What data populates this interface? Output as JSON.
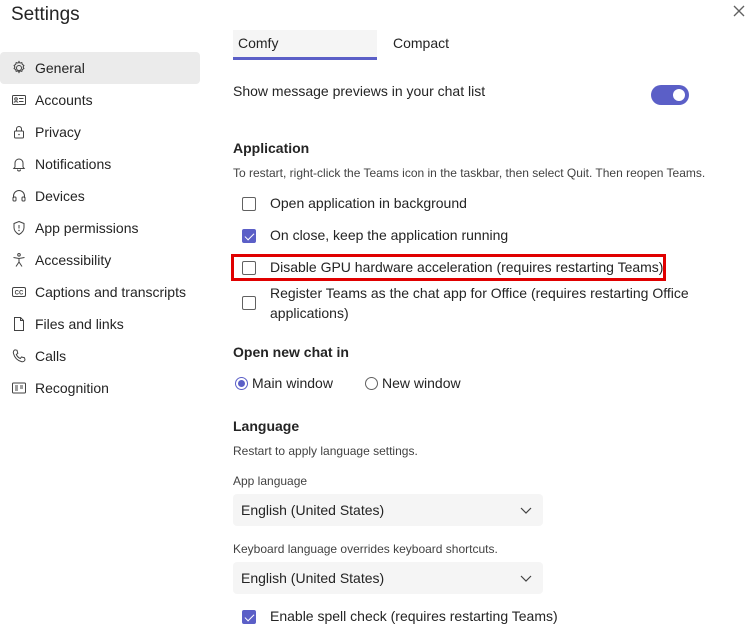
{
  "window": {
    "title": "Settings"
  },
  "sidebar": {
    "items": [
      {
        "label": "General",
        "icon": "gear-icon"
      },
      {
        "label": "Accounts",
        "icon": "id-card-icon"
      },
      {
        "label": "Privacy",
        "icon": "lock-icon"
      },
      {
        "label": "Notifications",
        "icon": "bell-icon"
      },
      {
        "label": "Devices",
        "icon": "headset-icon"
      },
      {
        "label": "App permissions",
        "icon": "shield-icon"
      },
      {
        "label": "Accessibility",
        "icon": "accessibility-icon"
      },
      {
        "label": "Captions and transcripts",
        "icon": "cc-icon"
      },
      {
        "label": "Files and links",
        "icon": "file-icon"
      },
      {
        "label": "Calls",
        "icon": "phone-icon"
      },
      {
        "label": "Recognition",
        "icon": "recognition-icon"
      }
    ],
    "active": "General"
  },
  "density": {
    "comfy": "Comfy",
    "compact": "Compact",
    "selected": "Comfy"
  },
  "message_previews": {
    "label": "Show message previews in your chat list",
    "enabled": true
  },
  "application": {
    "heading": "Application",
    "hint": "To restart, right-click the Teams icon in the taskbar, then select Quit. Then reopen Teams.",
    "options": [
      {
        "label": "Open application in background",
        "checked": false
      },
      {
        "label": "On close, keep the application running",
        "checked": true
      },
      {
        "label": "Disable GPU hardware acceleration (requires restarting Teams)",
        "checked": false
      },
      {
        "label_line1": "Register Teams as the chat app for Office (requires restarting Office",
        "label_line2": "applications)",
        "checked": false
      }
    ]
  },
  "open_new_chat": {
    "heading": "Open new chat in",
    "main": "Main window",
    "new": "New window",
    "selected": "Main window"
  },
  "language": {
    "heading": "Language",
    "hint": "Restart to apply language settings.",
    "app_language_label": "App language",
    "app_language_value": "English (United States)",
    "keyboard_label": "Keyboard language overrides keyboard shortcuts.",
    "keyboard_value": "English (United States)",
    "spell_check": {
      "label": "Enable spell check (requires restarting Teams)",
      "checked": true
    }
  },
  "colors": {
    "accent": "#5b5fc7",
    "highlight": "#e00000"
  }
}
